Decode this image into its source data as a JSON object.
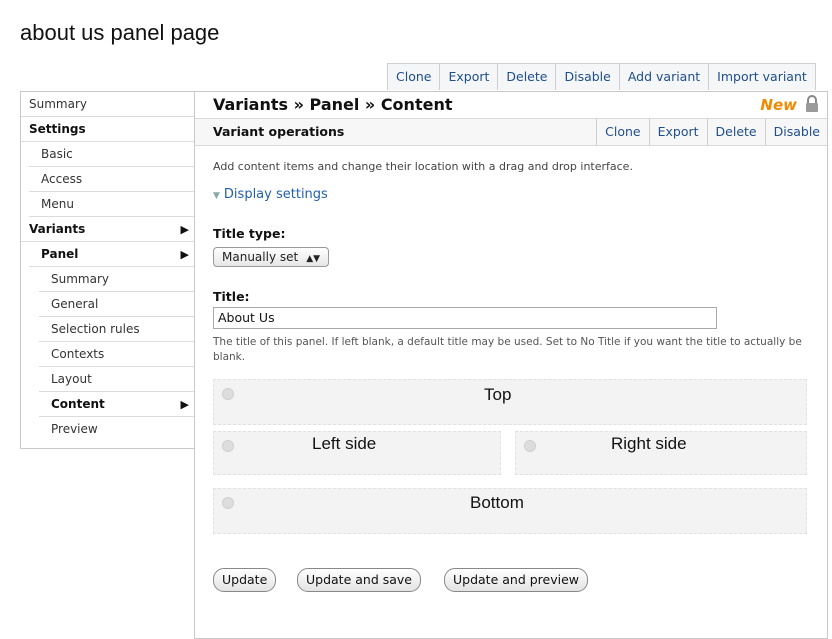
{
  "page": {
    "title": "about us panel page"
  },
  "top_ops": [
    "Clone",
    "Export",
    "Delete",
    "Disable",
    "Add variant",
    "Import variant"
  ],
  "sidebar": {
    "items": [
      {
        "label": "Summary"
      },
      {
        "label": "Settings"
      },
      {
        "label": "Basic"
      },
      {
        "label": "Access"
      },
      {
        "label": "Menu"
      },
      {
        "label": "Variants"
      },
      {
        "label": "Panel"
      },
      {
        "label": "Summary"
      },
      {
        "label": "General"
      },
      {
        "label": "Selection rules"
      },
      {
        "label": "Contexts"
      },
      {
        "label": "Layout"
      },
      {
        "label": "Content"
      },
      {
        "label": "Preview"
      }
    ],
    "arrow": "▶"
  },
  "main": {
    "breadcrumb": "Variants » Panel » Content",
    "new_badge": "New",
    "variant_title": "Variant operations",
    "variant_ops": [
      "Clone",
      "Export",
      "Delete",
      "Disable"
    ],
    "description": "Add content items and change their location with a drag and drop interface.",
    "display_settings": "Display settings",
    "title_type_label": "Title type:",
    "title_type_value": "Manually set",
    "title_label": "Title:",
    "title_value": "About Us",
    "help_text": "The title of this panel. If left blank, a default title may be used. Set to No Title if you want the title to actually be blank.",
    "regions": {
      "top": "Top",
      "left": "Left side",
      "right": "Right side",
      "bottom": "Bottom"
    },
    "buttons": {
      "update": "Update",
      "update_save": "Update and save",
      "update_preview": "Update and preview"
    }
  },
  "colors": {
    "link": "#1f4e8c",
    "new": "#f08a00"
  }
}
